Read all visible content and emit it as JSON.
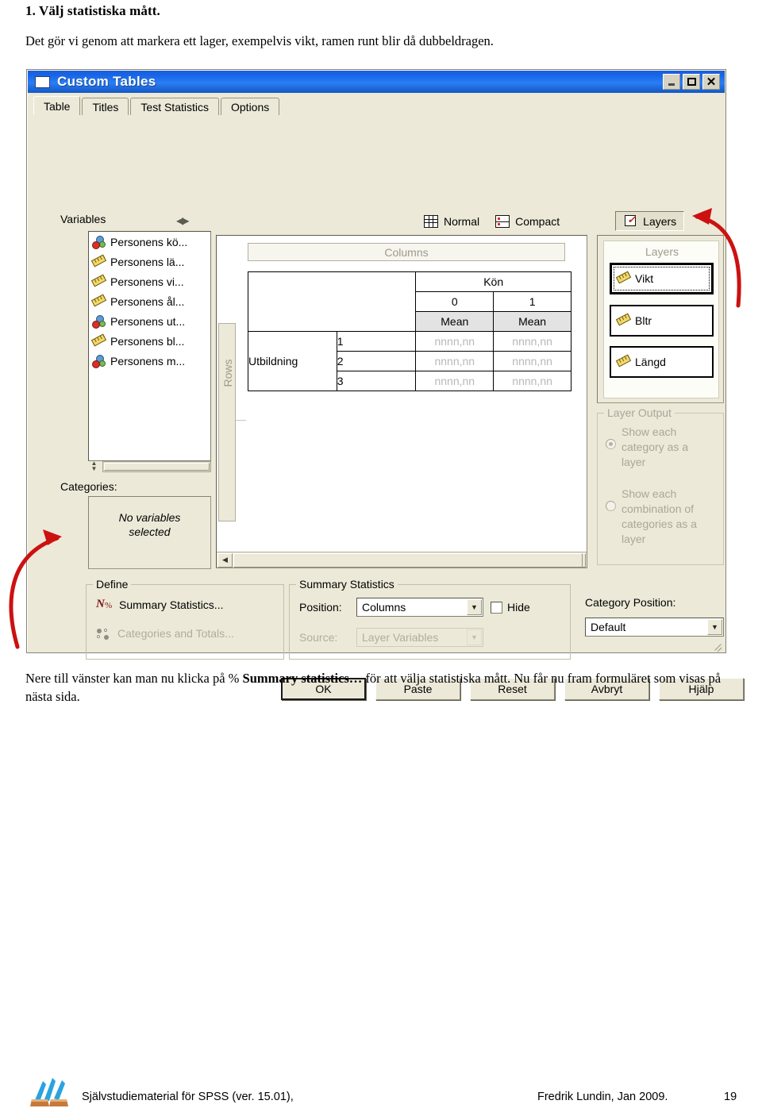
{
  "document": {
    "heading": "1. Välj statistiska mått.",
    "paragraph1": "Det gör vi genom att markera ett lager, exempelvis vikt, ramen runt blir då dubbeldragen.",
    "paragraph2_pre": "Nere till vänster kan man nu klicka på  % ",
    "paragraph2_bold": "Summary statistics…",
    "paragraph2_post": " för att välja statistiska mått. Nu får nu fram formuläret som visas på nästa sida."
  },
  "footer": {
    "left": "Självstudiematerial för SPSS (ver. 15.01),",
    "right": "Fredrik Lundin, Jan 2009.",
    "page": "19"
  },
  "dialog": {
    "title": "Custom Tables",
    "window_buttons": {
      "minimize": "minimize-icon",
      "maximize": "maximize-icon",
      "close": "close-icon"
    },
    "tabs": [
      {
        "label": "Table",
        "active": true
      },
      {
        "label": "Titles",
        "active": false
      },
      {
        "label": "Test Statistics",
        "active": false
      },
      {
        "label": "Options",
        "active": false
      }
    ],
    "variables": {
      "label": "Variables",
      "items": [
        {
          "name": "Personens kö...",
          "icon": "nominal-icon"
        },
        {
          "name": "Personens lä...",
          "icon": "scale-icon"
        },
        {
          "name": "Personens vi...",
          "icon": "scale-icon"
        },
        {
          "name": "Personens ål...",
          "icon": "scale-icon"
        },
        {
          "name": "Personens ut...",
          "icon": "nominal-icon"
        },
        {
          "name": "Personens bl...",
          "icon": "scale-icon"
        },
        {
          "name": "Personens m...",
          "icon": "nominal-icon"
        }
      ]
    },
    "categories": {
      "label": "Categories:",
      "empty_line1": "No variables",
      "empty_line2": "selected"
    },
    "viewbar": [
      {
        "label": "Normal",
        "icon": "normal-view-icon",
        "pressed": false
      },
      {
        "label": "Compact",
        "icon": "compact-view-icon",
        "pressed": false
      },
      {
        "label": "Layers",
        "icon": "layers-view-icon",
        "pressed": true
      }
    ],
    "preview": {
      "columns_drop_label": "Columns",
      "rows_rail_label": "Rows",
      "table": {
        "column_group": "Kön",
        "column_categories": [
          "0",
          "1"
        ],
        "statistic_headers": [
          "Mean",
          "Mean"
        ],
        "row_group": "Utbildning",
        "row_categories": [
          "1",
          "2",
          "3"
        ],
        "cell_values": [
          [
            "nnnn,nn",
            "nnnn,nn"
          ],
          [
            "nnnn,nn",
            "nnnn,nn"
          ],
          [
            "nnnn,nn",
            "nnnn,nn"
          ]
        ]
      }
    },
    "layers": {
      "caption": "Layers",
      "chips": [
        {
          "label": "Vikt",
          "icon": "scale-icon",
          "selected": true
        },
        {
          "label": "Bltr",
          "icon": "scale-icon",
          "selected": false
        },
        {
          "label": "Längd",
          "icon": "scale-icon",
          "selected": false
        }
      ]
    },
    "layer_output": {
      "title": "Layer Output",
      "options": [
        {
          "label": "Show each category as a layer",
          "selected": true
        },
        {
          "label": "Show each combination of categories as a layer",
          "selected": false
        }
      ]
    },
    "define": {
      "title": "Define",
      "summary_statistics": "Summary Statistics...",
      "categories_and_totals": "Categories and Totals..."
    },
    "summary_statistics": {
      "title": "Summary Statistics",
      "position_label": "Position:",
      "position_value": "Columns",
      "hide_label": "Hide",
      "hide_checked": false,
      "source_label": "Source:",
      "source_value": "Layer Variables"
    },
    "category_position": {
      "label": "Category Position:",
      "value": "Default"
    },
    "buttons": [
      {
        "label": "OK",
        "default": true
      },
      {
        "label": "Paste",
        "default": false
      },
      {
        "label": "Reset",
        "default": false
      },
      {
        "label": "Avbryt",
        "default": false
      },
      {
        "label": "Hjälp",
        "default": false
      }
    ]
  },
  "annotations": {
    "arrow_right_target": "Vikt layer chip",
    "arrow_left_target": "Summary Statistics button"
  },
  "colors": {
    "title_bar_blue": "#1763e6",
    "dialog_face": "#ece9d8",
    "annotation_red": "#cc1111"
  }
}
